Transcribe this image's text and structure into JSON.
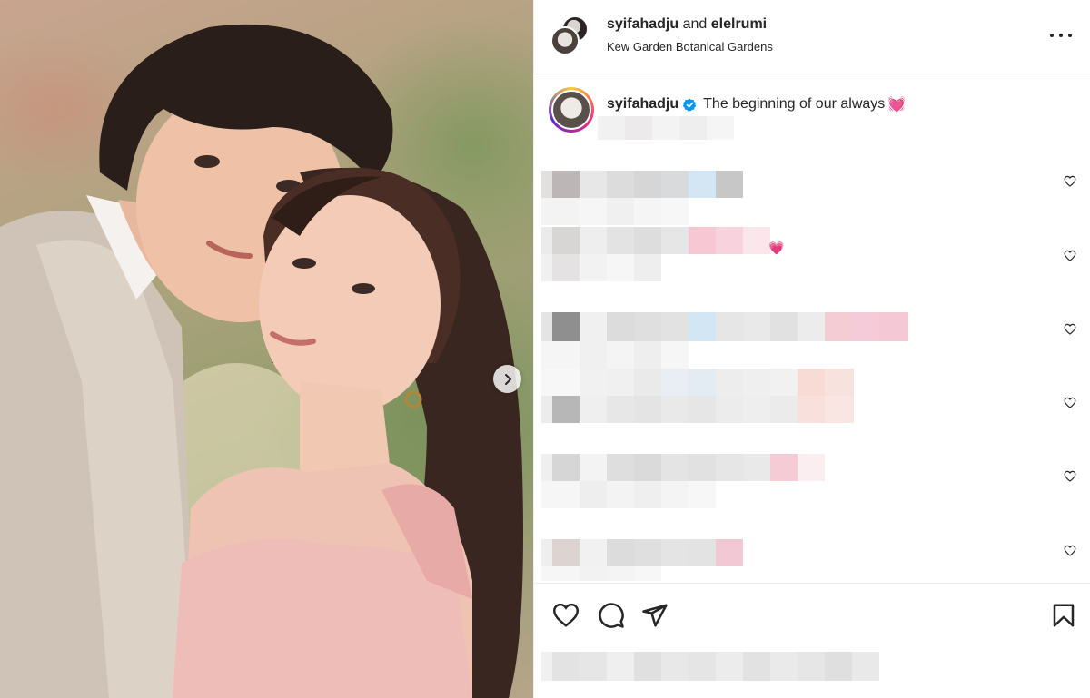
{
  "post": {
    "authors": {
      "primary": "syifahadju",
      "joiner": "and",
      "secondary": "elelrumi"
    },
    "location": "Kew Garden Botanical Gardens",
    "caption": {
      "username": "syifahadju",
      "text": "The beginning of our always",
      "emoji": "💓"
    }
  },
  "icons": {
    "more": "more-options-icon",
    "verified": "verified-badge-icon",
    "next": "chevron-right-icon",
    "like": "heart-icon",
    "comment": "comment-icon",
    "share": "send-icon",
    "save": "bookmark-icon"
  },
  "colors": {
    "verified": "#0095f6",
    "text": "#262626",
    "border": "#efefef"
  }
}
